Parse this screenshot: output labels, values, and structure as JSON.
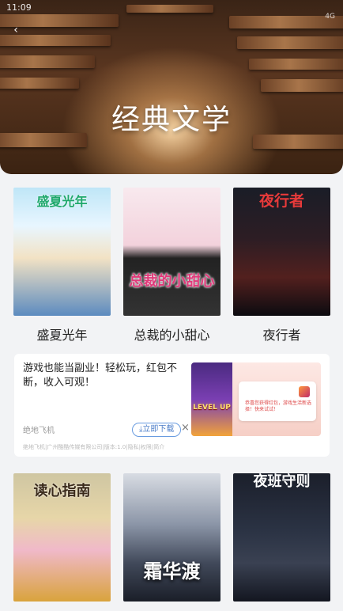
{
  "status": {
    "time": "11:09",
    "right": "4G"
  },
  "header": {
    "title": "经典文学",
    "back_icon": "‹"
  },
  "books": [
    {
      "title": "盛夏光年",
      "cover_text": "盛夏光年"
    },
    {
      "title": "总裁的小甜心",
      "cover_text": "总裁的小甜心"
    },
    {
      "title": "夜行者",
      "cover_text": "夜行者"
    },
    {
      "cover_text": "读心指南"
    },
    {
      "cover_text": "霜华渡"
    },
    {
      "cover_text": "夜班守则"
    }
  ],
  "ad": {
    "text": "游戏也能当副业！轻松玩，红包不断，收入可观！",
    "brand": "绝地飞机",
    "download": "立即下载",
    "close": "×",
    "legal": "绝地飞机|广州酷酷传媒有限公司|版本:1.0|隐私|权限|简介",
    "game_level": "LEVEL UP",
    "card_text": "恭喜您获得红包，游戏生活新选择！快来试试！"
  }
}
